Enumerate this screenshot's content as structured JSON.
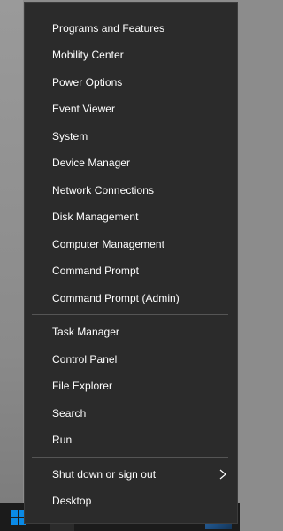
{
  "menu": {
    "group1": [
      {
        "label": "Programs and Features"
      },
      {
        "label": "Mobility Center"
      },
      {
        "label": "Power Options"
      },
      {
        "label": "Event Viewer"
      },
      {
        "label": "System"
      },
      {
        "label": "Device Manager"
      },
      {
        "label": "Network Connections"
      },
      {
        "label": "Disk Management"
      },
      {
        "label": "Computer Management"
      },
      {
        "label": "Command Prompt"
      },
      {
        "label": "Command Prompt (Admin)"
      }
    ],
    "group2": [
      {
        "label": "Task Manager"
      },
      {
        "label": "Control Panel"
      },
      {
        "label": "File Explorer"
      },
      {
        "label": "Search"
      },
      {
        "label": "Run"
      }
    ],
    "group3": [
      {
        "label": "Shut down or sign out",
        "has_submenu": true
      },
      {
        "label": "Desktop"
      }
    ]
  },
  "icons": {
    "submenu": "chevron-right-icon",
    "start": "windows-logo-icon"
  },
  "colors": {
    "menu_background": "#2b2b2b",
    "menu_text": "#ffffff",
    "separator": "#555555",
    "windows_blue": "#0a8ae6"
  }
}
